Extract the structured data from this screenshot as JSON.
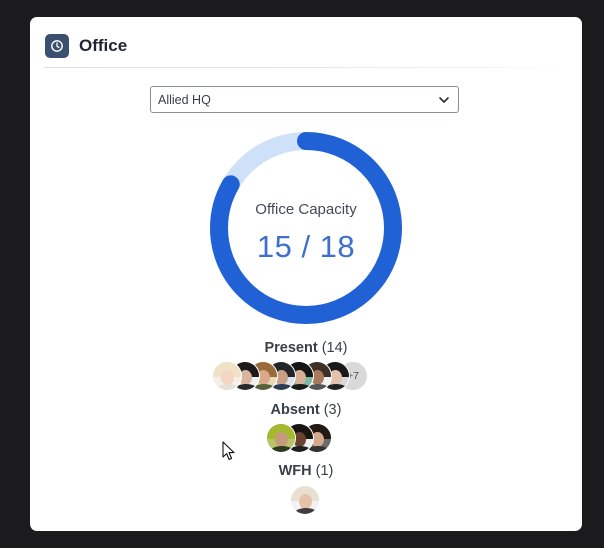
{
  "card": {
    "title": "Office",
    "title_icon": "clock-icon"
  },
  "location_select": {
    "value": "Allied HQ",
    "icon": "chevron-down-icon"
  },
  "capacity": {
    "label": "Office Capacity",
    "display": "15 / 18",
    "occupied": 15,
    "total": 18,
    "colors": {
      "filled": "#2161d6",
      "remaining": "#cfe1f9"
    }
  },
  "groups": [
    {
      "name": "Present",
      "count_text": "(14)",
      "avatars": [
        {
          "hair": "#efe2c7",
          "skin": "#f2d6c2",
          "shirt": "#e6e0da",
          "bg": "#f4efe8"
        },
        {
          "hair": "#1d1a19",
          "skin": "#d9b59b",
          "shirt": "#2a2a2a",
          "bg": "#f0f0f0"
        },
        {
          "hair": "#9a6a3a",
          "skin": "#d9a98a",
          "shirt": "#56603a",
          "bg": "#e9d9b8"
        },
        {
          "hair": "#222428",
          "skin": "#c9a084",
          "shirt": "#2b3a55",
          "bg": "#dfe3ea"
        },
        {
          "hair": "#151515",
          "skin": "#d6b196",
          "shirt": "#1a1a1a",
          "bg": "#7ab9a8"
        },
        {
          "hair": "#3d3026",
          "skin": "#a87a5c",
          "shirt": "#555555",
          "bg": "#f2f2f2"
        },
        {
          "hair": "#1a1a1a",
          "skin": "#e3c2ab",
          "shirt": "#222222",
          "bg": "#d8d8d8"
        }
      ],
      "more": "+7"
    },
    {
      "name": "Absent",
      "count_text": "(3)",
      "avatars": [
        {
          "hair": "#a6b82f",
          "skin": "#c59b7c",
          "shirt": "#2e3a22",
          "bg": "#b9c46a"
        },
        {
          "hair": "#1a1411",
          "skin": "#6b4430",
          "shirt": "#1f1f1f",
          "bg": "#efefef"
        },
        {
          "hair": "#231a15",
          "skin": "#d4aa8c",
          "shirt": "#333333",
          "bg": "#6b6b6b"
        }
      ],
      "more": ""
    },
    {
      "name": "WFH",
      "count_text": "(1)",
      "avatars": [
        {
          "hair": "#e8e1d2",
          "skin": "#e6c3a8",
          "shirt": "#3d3d3d",
          "bg": "#f2f2f2"
        }
      ],
      "more": ""
    }
  ],
  "cursor_icon": "mouse-pointer-icon"
}
